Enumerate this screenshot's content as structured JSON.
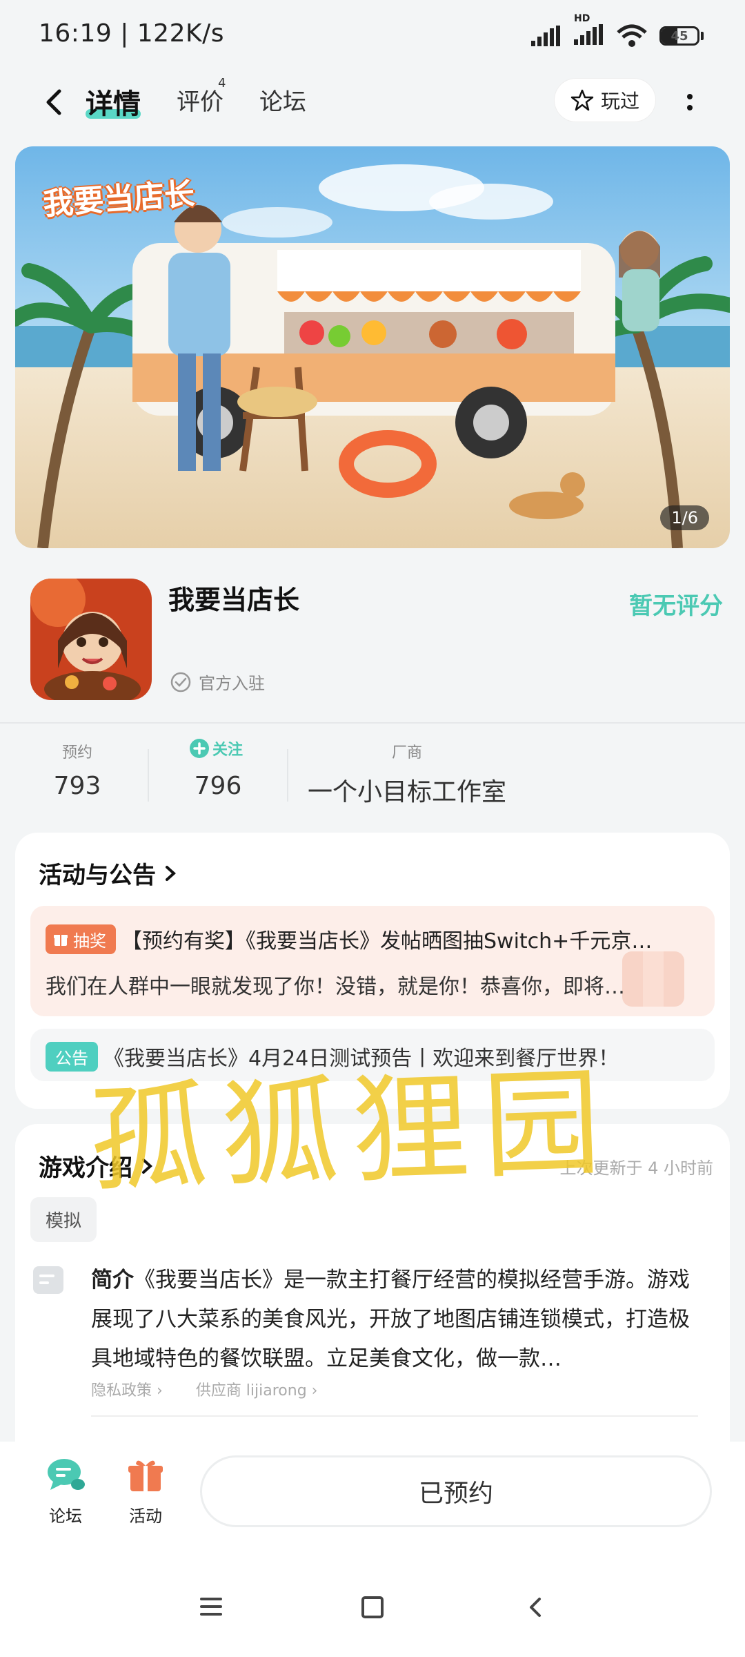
{
  "status_bar": {
    "time": "16:19 | 122K/s",
    "hd_label": "HD",
    "battery": "45"
  },
  "top_nav": {
    "tabs": [
      {
        "label": "详情",
        "active": true
      },
      {
        "label": "评价",
        "badge": "4"
      },
      {
        "label": "论坛"
      }
    ],
    "played_label": "玩过"
  },
  "banner": {
    "logo_text": "我要当店长",
    "counter": "1/6"
  },
  "app": {
    "name": "我要当店长",
    "official_label": "官方入驻",
    "rating_text": "暂无评分"
  },
  "stats": {
    "reserve_label": "预约",
    "reserve_value": "793",
    "follow_label": "关注",
    "follow_value": "796",
    "vendor_label": "厂商",
    "vendor_value": "一个小目标工作室"
  },
  "activities": {
    "title": "活动与公告",
    "items": [
      {
        "tag": "抽奖",
        "title": "【预约有奖】《我要当店长》发帖晒图抽Switch+千元京…",
        "body": "我们在人群中一眼就发现了你！没错，就是你！恭喜你，即将…"
      },
      {
        "tag": "公告",
        "title": "《我要当店长》4月24日测试预告丨欢迎来到餐厅世界！"
      }
    ]
  },
  "game_intro": {
    "title": "游戏介绍",
    "updated": "上次更新于 4 小时前",
    "genre": "模拟",
    "intro_label": "简介",
    "intro_text": "《我要当店长》是一款主打餐厅经营的模拟经营手游。游戏展现了八大菜系的美食风光，开放了地图店铺连锁模式，打造极具地域特色的餐饮联盟。立足美食文化，做一款…",
    "privacy_link": "隐私政策",
    "supplier_link": "供应商 lijiarong"
  },
  "bottom_bar": {
    "forum_label": "论坛",
    "activity_label": "活动",
    "reserved_label": "已预约"
  },
  "watermark": "孤狐狸园",
  "colors": {
    "accent": "#4bc9b3",
    "lottery": "#f07a50",
    "notice": "#4fcfc0"
  }
}
